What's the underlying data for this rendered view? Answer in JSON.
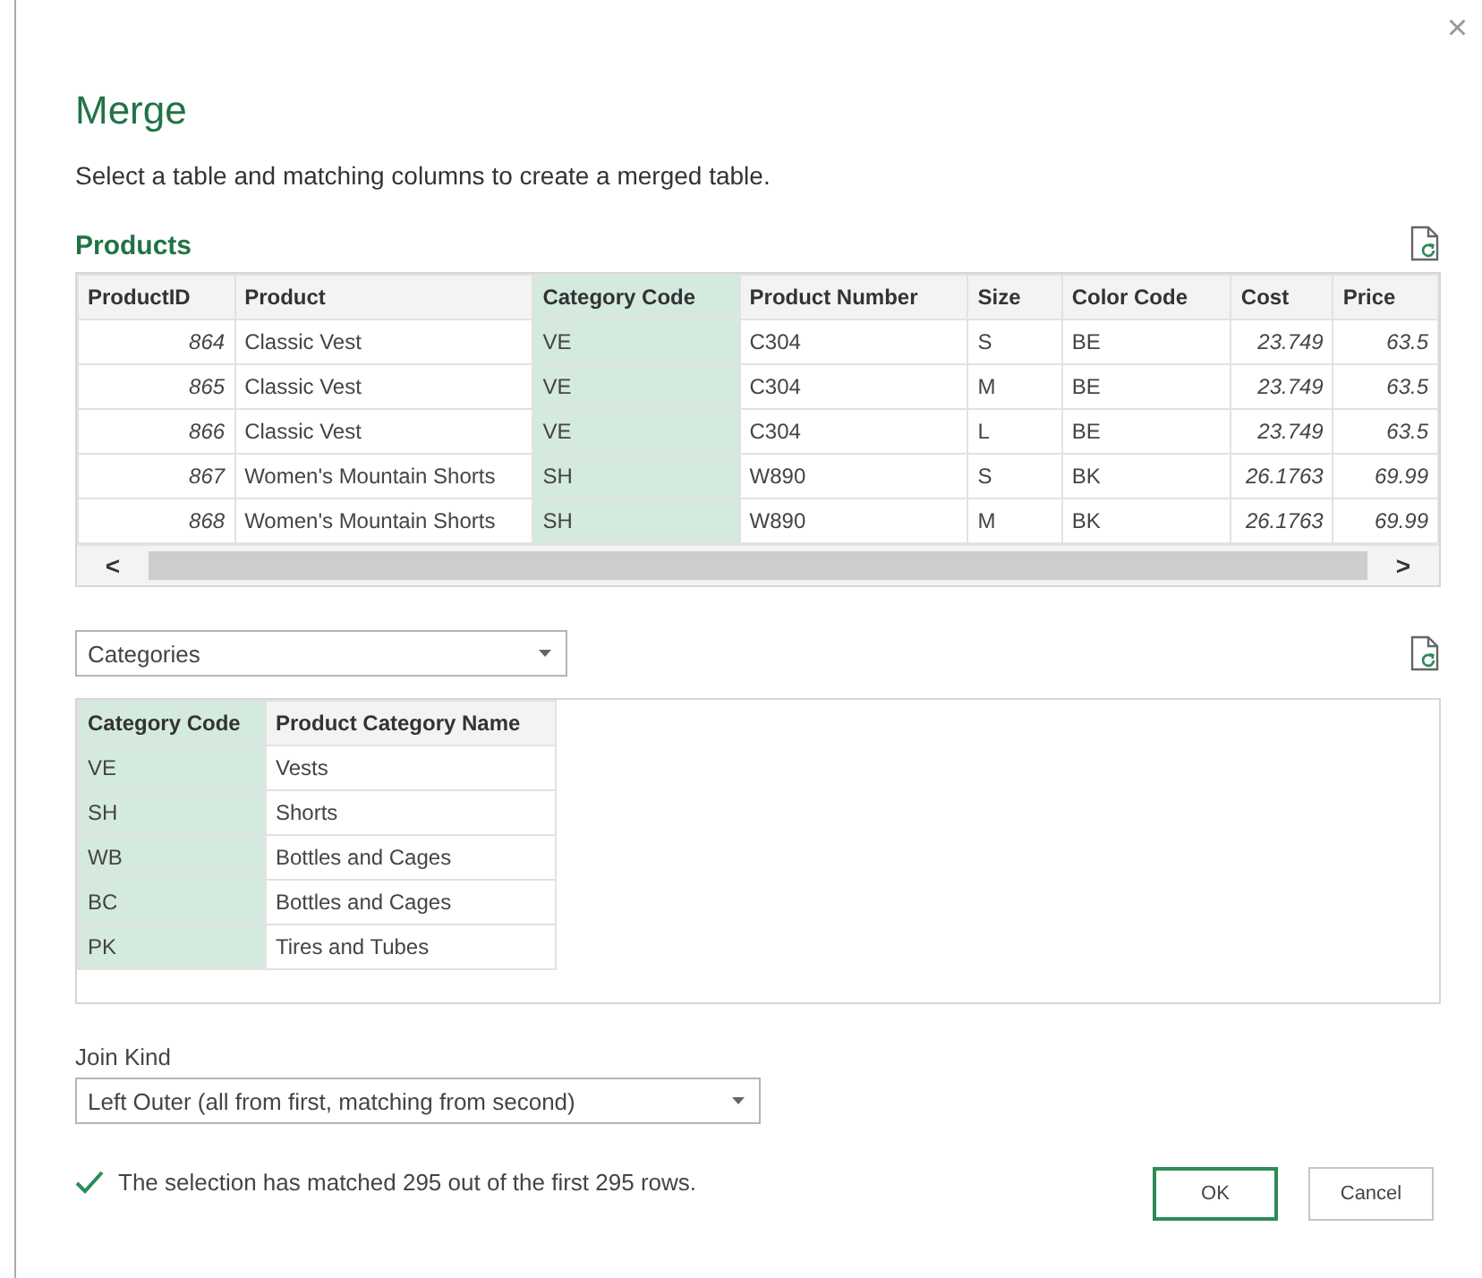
{
  "dialog": {
    "title": "Merge",
    "close_icon": "×",
    "instruction": "Select a table and matching columns to create a merged table."
  },
  "first_table": {
    "name": "Products",
    "columns": [
      {
        "label": "ProductID",
        "kind": "number",
        "selected": false
      },
      {
        "label": "Product",
        "kind": "text",
        "selected": false
      },
      {
        "label": "Category Code",
        "kind": "text",
        "selected": true
      },
      {
        "label": "Product Number",
        "kind": "text",
        "selected": false
      },
      {
        "label": "Size",
        "kind": "text",
        "selected": false
      },
      {
        "label": "Color Code",
        "kind": "text",
        "selected": false
      },
      {
        "label": "Cost",
        "kind": "number",
        "selected": false
      },
      {
        "label": "Price",
        "kind": "number",
        "selected": false
      }
    ],
    "rows": [
      [
        "864",
        "Classic Vest",
        "VE",
        "C304",
        "S",
        "BE",
        "23.749",
        "63.5"
      ],
      [
        "865",
        "Classic Vest",
        "VE",
        "C304",
        "M",
        "BE",
        "23.749",
        "63.5"
      ],
      [
        "866",
        "Classic Vest",
        "VE",
        "C304",
        "L",
        "BE",
        "23.749",
        "63.5"
      ],
      [
        "867",
        "Women's Mountain Shorts",
        "SH",
        "W890",
        "S",
        "BK",
        "26.1763",
        "69.99"
      ],
      [
        "868",
        "Women's Mountain Shorts",
        "SH",
        "W890",
        "M",
        "BK",
        "26.1763",
        "69.99"
      ]
    ],
    "scroll_left": "<",
    "scroll_right": ">"
  },
  "second_table": {
    "selector": "Categories",
    "columns": [
      {
        "label": "Category Code",
        "selected": true
      },
      {
        "label": "Product Category Name",
        "selected": false
      }
    ],
    "rows": [
      [
        "VE",
        "Vests"
      ],
      [
        "SH",
        "Shorts"
      ],
      [
        "WB",
        "Bottles and Cages"
      ],
      [
        "BC",
        "Bottles and Cages"
      ],
      [
        "PK",
        "Tires and Tubes"
      ]
    ]
  },
  "join": {
    "label": "Join Kind",
    "value": "Left Outer (all from first, matching from second)"
  },
  "status": {
    "matched": true,
    "text": "The selection has matched 295 out of the first 295 rows."
  },
  "buttons": [
    {
      "label": "OK",
      "default": true
    },
    {
      "label": "Cancel",
      "default": false
    }
  ]
}
